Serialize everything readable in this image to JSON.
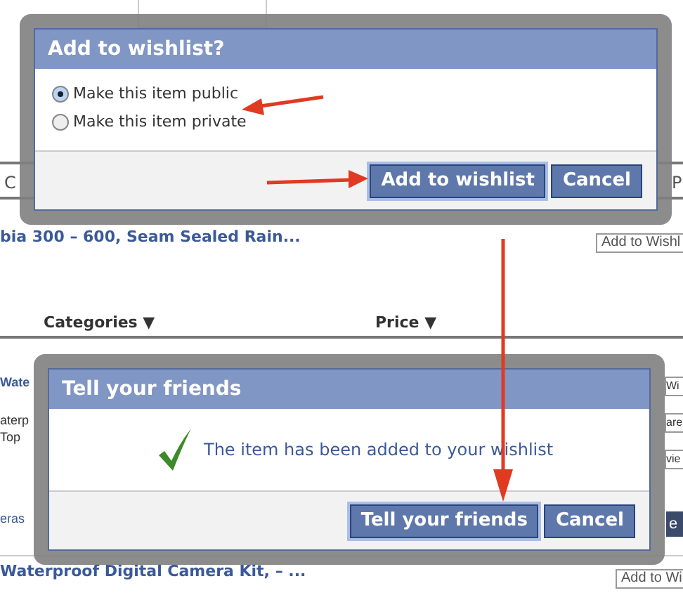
{
  "background": {
    "header_fragments": [
      "C",
      "P"
    ],
    "item_1": {
      "title": "bia 300 – 600, Seam Sealed Rain...",
      "button": "Add to Wishl"
    },
    "columns": [
      "Categories ▼",
      "Price ▼"
    ],
    "item_2": {
      "title": "Wate",
      "lines": [
        "aterp",
        "Top"
      ],
      "footer": "eras",
      "buttons": [
        "Wi",
        "are",
        "vie"
      ],
      "dark_button": "e"
    },
    "item_3": {
      "title": "Waterproof Digital Camera Kit, – ...",
      "button": "Add to Wi"
    }
  },
  "wishlist_dialog": {
    "title": "Add to wishlist?",
    "options": [
      {
        "label": "Make this item public",
        "selected": true
      },
      {
        "label": "Make this item private",
        "selected": false
      }
    ],
    "buttons": [
      {
        "label": "Add to wishlist",
        "focused": true
      },
      {
        "label": "Cancel",
        "focused": false
      }
    ]
  },
  "friends_dialog": {
    "title": "Tell your friends",
    "message": "The item has been added to your wishlist",
    "buttons": [
      {
        "label": "Tell your friends",
        "focused": true
      },
      {
        "label": "Cancel",
        "focused": false
      }
    ]
  }
}
